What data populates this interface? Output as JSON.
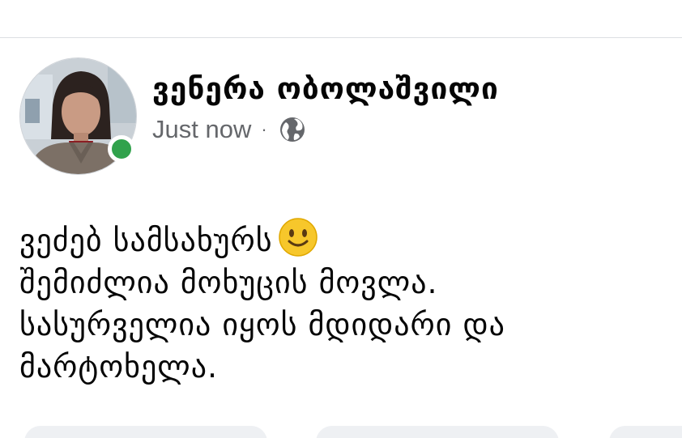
{
  "post": {
    "author": "ვენერა ობოლაშვილი",
    "timestamp": "Just now",
    "separator": "·",
    "privacy_icon": "globe-icon",
    "online_status_color": "#31a24c",
    "lines": [
      "ვეძებ სამსახურს",
      "შემიძლია მოხუცის მოვლა.",
      "სასურველია იყოს მდიდარი და",
      "მარტოხელა."
    ],
    "emoji": "slightly-smiling-face-icon"
  },
  "colors": {
    "meta_text": "#65676b",
    "action_bg": "#eef0f3"
  }
}
